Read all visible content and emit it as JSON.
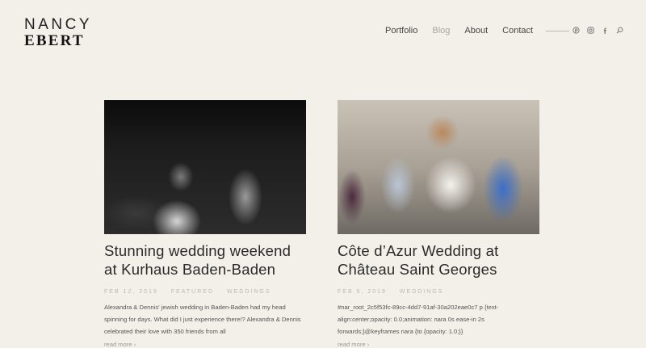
{
  "logo": {
    "line1": "NANCY",
    "line2": "EBERT"
  },
  "nav": {
    "items": [
      "Portfolio",
      "Blog",
      "About",
      "Contact"
    ]
  },
  "social_icons": [
    "pinterest-icon",
    "instagram-icon",
    "facebook-icon",
    "search-icon"
  ],
  "posts": [
    {
      "title": "Stunning wedding weekend at Kurhaus Baden-Baden",
      "date": "FEB 12, 2019",
      "categories": [
        "FEATURED",
        "WEDDINGS"
      ],
      "excerpt": "Alexandra & Dennis' jewish wedding in Baden-Baden had my head spinning for days. What did I just experience there!? Alexandra & Dennis celebrated their love with 350 friends from all",
      "read_more": "read more ›"
    },
    {
      "title": "Côte d’Azur Wedding at Château Saint Georges",
      "date": "FEB 5, 2019",
      "categories": [
        "WEDDINGS"
      ],
      "excerpt": "#nar_root_2c5f53fc-89cc-4dd7-91af-30a202eae0c7 p {text-align:center;opacity: 0.0;animation: nara 0s ease-in 2s forwards;}@keyframes nara {to {opacity: 1.0;}}",
      "read_more": "read more ›"
    }
  ]
}
